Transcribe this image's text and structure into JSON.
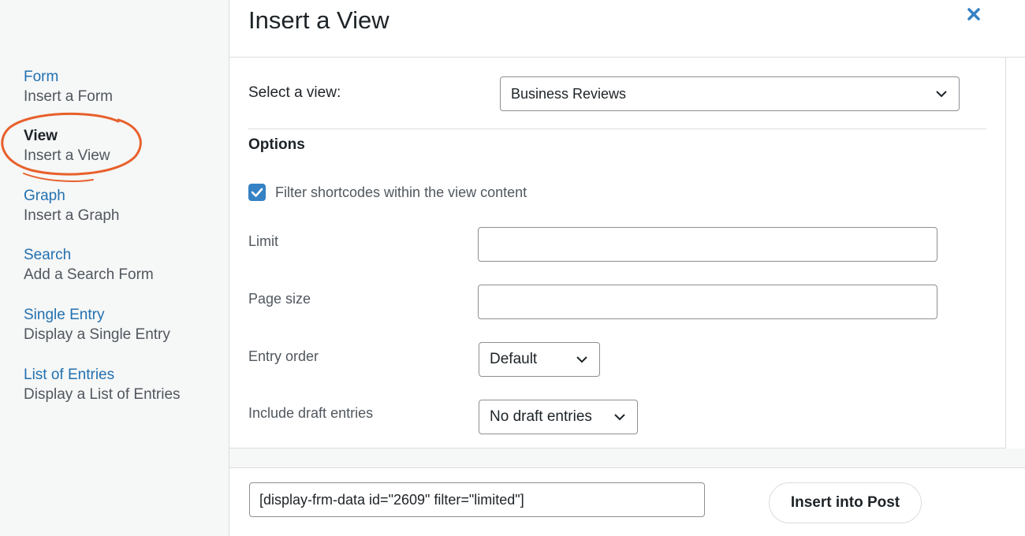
{
  "sidebar": {
    "items": [
      {
        "title": "Form",
        "subtitle": "Insert a Form"
      },
      {
        "title": "View",
        "subtitle": "Insert a View"
      },
      {
        "title": "Graph",
        "subtitle": "Insert a Graph"
      },
      {
        "title": "Search",
        "subtitle": "Add a Search Form"
      },
      {
        "title": "Single Entry",
        "subtitle": "Display a Single Entry"
      },
      {
        "title": "List of Entries",
        "subtitle": "Display a List of Entries"
      }
    ],
    "active_index": 1
  },
  "header": {
    "title": "Insert a View"
  },
  "form": {
    "select_view_label": "Select a view:",
    "select_view_value": "Business Reviews",
    "options_heading": "Options",
    "filter_checkbox_label": "Filter shortcodes within the view content",
    "filter_checked": true,
    "limit_label": "Limit",
    "limit_value": "",
    "page_size_label": "Page size",
    "page_size_value": "",
    "entry_order_label": "Entry order",
    "entry_order_value": "Default",
    "draft_label": "Include draft entries",
    "draft_value": "No draft entries"
  },
  "footer": {
    "shortcode": "[display-frm-data id=\"2609\" filter=\"limited\"]",
    "insert_button": "Insert into Post"
  },
  "colors": {
    "accent": "#2271b1",
    "highlight": "#e8602c",
    "checkbox": "#3582c4",
    "close": "#3582c4"
  }
}
